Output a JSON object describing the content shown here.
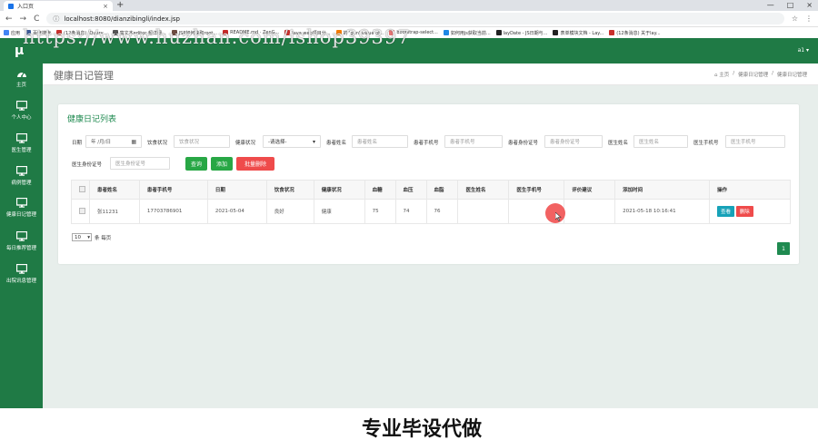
{
  "browser": {
    "tab_title": "入口页",
    "tab_close": "×",
    "new_tab": "+",
    "minimize": "—",
    "maximize": "□",
    "close": "×",
    "back": "←",
    "forward": "→",
    "reload": "C",
    "url": "localhost:8080/dianzibingli/index.jsp",
    "star": "☆",
    "menu": "⋮"
  },
  "bookmarks": [
    {
      "label": "应用",
      "color": "#4285f4"
    },
    {
      "label": "百度搜索",
      "color": "#3b5998"
    },
    {
      "label": "(12条消息) JQuery...",
      "color": "#c9302c"
    },
    {
      "label": "富文本editor 超详细...",
      "color": "#555555"
    },
    {
      "label": "JSP如何获取root...",
      "color": "#6d4c41"
    },
    {
      "label": "README.md · ZenG...",
      "color": "#c62828"
    },
    {
      "label": "Java web项目分...",
      "color": "#c9302c"
    },
    {
      "label": "的 'gen' value of...",
      "color": "#f57c00"
    },
    {
      "label": "bootstrap-select...",
      "color": "#e57373"
    },
    {
      "label": "如何用js获取当前...",
      "color": "#1e88e5"
    },
    {
      "label": "layDate - JS日期与...",
      "color": "#222222"
    },
    {
      "label": "表单模块文档 - Lay...",
      "color": "#222222"
    },
    {
      "label": "(12条消息) 关于lay...",
      "color": "#c9302c"
    }
  ],
  "watermark": "https://www.huzhan.com/ishop39397",
  "app": {
    "logo": "μ",
    "user": "a1 ▾"
  },
  "sidebar": {
    "items": [
      {
        "label": "主页",
        "icon": "dashboard-icon"
      },
      {
        "label": "个人中心",
        "icon": "monitor-icon"
      },
      {
        "label": "医生管理",
        "icon": "monitor-icon"
      },
      {
        "label": "病例管理",
        "icon": "monitor-icon"
      },
      {
        "label": "健康日记管理",
        "icon": "monitor-icon"
      },
      {
        "label": "每日推荐管理",
        "icon": "monitor-icon"
      },
      {
        "label": "出院讯息管理",
        "icon": "monitor-icon"
      }
    ]
  },
  "header": {
    "title": "健康日记管理",
    "breadcrumbs": [
      "⌂ 主页",
      "/",
      "健康日记管理",
      "/",
      "健康日记管理"
    ]
  },
  "card": {
    "title": "健康日记列表"
  },
  "form": {
    "date_label": "日期",
    "date_value": "年 /月/日",
    "diet_label": "饮食状况",
    "diet_placeholder": "饮食状况",
    "health_label": "健康状况",
    "health_select": "-请选择-",
    "patient_name_label": "患者姓名",
    "patient_name_placeholder": "患者姓名",
    "patient_phone_label": "患者手机号",
    "patient_phone_placeholder": "患者手机号",
    "patient_id_label": "患者身份证号",
    "patient_id_placeholder": "患者身份证号",
    "doctor_name_label": "医生姓名",
    "doctor_name_placeholder": "医生姓名",
    "doctor_phone_label": "医生手机号",
    "doctor_phone_placeholder": "医生手机号",
    "doctor_id_label": "医生身份证号",
    "doctor_id_placeholder": "医生身份证号",
    "query_btn": "查询",
    "add_btn": "添加",
    "batch_delete_btn": "批量删除"
  },
  "table": {
    "columns": [
      "患者姓名",
      "患者手机号",
      "日期",
      "饮食状况",
      "健康状况",
      "血糖",
      "血压",
      "血脂",
      "医生姓名",
      "医生手机号",
      "评价建议",
      "添加时间",
      "操作"
    ],
    "rows": [
      [
        "张11231",
        "17703786901",
        "2021-05-04",
        "良好",
        "健康",
        "75",
        "74",
        "76",
        "",
        "",
        "",
        "2021-05-18 10:16:41"
      ]
    ],
    "view_btn": "查看",
    "delete_btn": "删除"
  },
  "pagination": {
    "page_size": "10",
    "page_size_suffix": "条 每页",
    "current_page": "1"
  },
  "banner": {
    "text": "专业毕设代做"
  }
}
